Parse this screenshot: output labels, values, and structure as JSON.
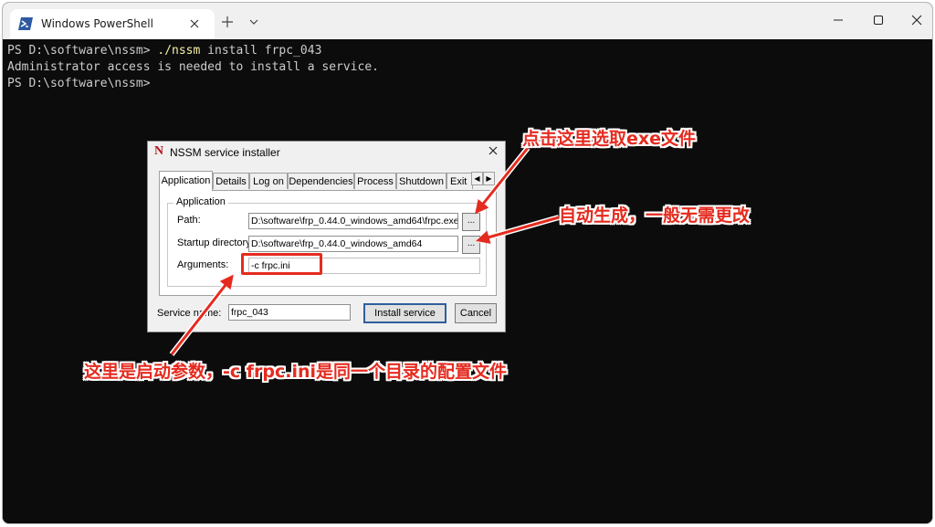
{
  "window": {
    "tab_title": "Windows PowerShell"
  },
  "terminal": {
    "lines": [
      {
        "prompt": "PS D:\\software\\nssm> ",
        "exec": "./nssm",
        "args": " install frpc_043"
      },
      {
        "text": "Administrator access is needed to install a service."
      },
      {
        "prompt": "PS D:\\software\\nssm> "
      }
    ]
  },
  "dialog": {
    "logo": "N",
    "title": "NSSM service installer",
    "tabs": [
      "Application",
      "Details",
      "Log on",
      "Dependencies",
      "Process",
      "Shutdown",
      "Exit"
    ],
    "active_tab": "Application",
    "group_label": "Application",
    "path_label": "Path:",
    "path_value": "D:\\software\\frp_0.44.0_windows_amd64\\frpc.exe",
    "startup_label": "Startup directory:",
    "startup_value": "D:\\software\\frp_0.44.0_windows_amd64",
    "args_label": "Arguments:",
    "args_value": "-c frpc.ini",
    "browse_label": "...",
    "service_name_label": "Service name:",
    "service_name_value": "frpc_043",
    "install_button": "Install service",
    "cancel_button": "Cancel"
  },
  "annotations": {
    "note_path": "点击这里选取exe文件",
    "note_startup": "自动生成，一般无需更改",
    "note_args": "这里是启动参数，-c frpc.ini是同一个目录的配置文件"
  },
  "colors": {
    "terminal_bg": "#0c0c0c",
    "terminal_fg": "#cccccc",
    "exec_yellow": "#f9f1a5",
    "annotation_red": "#e52b1f"
  }
}
